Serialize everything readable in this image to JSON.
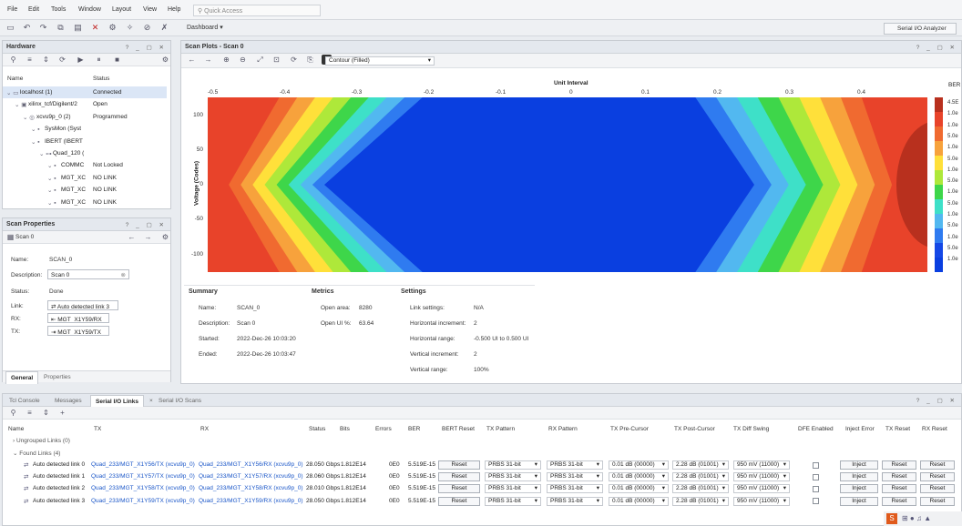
{
  "menu": [
    "File",
    "Edit",
    "Tools",
    "Window",
    "Layout",
    "View",
    "Help"
  ],
  "quick_access_placeholder": "Quick Access",
  "dashboard_label": "Dashboard",
  "analyzer_button": "Serial I/O Analyzer",
  "hardware": {
    "title": "Hardware",
    "col_name": "Name",
    "col_status": "Status",
    "rows": [
      {
        "name": "localhost (1)",
        "status": "Connected",
        "indent": 0
      },
      {
        "name": "xilinx_tcf/Digilent/2",
        "status": "Open",
        "indent": 1
      },
      {
        "name": "xcvu9p_0 (2)",
        "status": "Programmed",
        "indent": 2
      },
      {
        "name": "SysMon (Syst",
        "status": "",
        "indent": 3
      },
      {
        "name": "IBERT (IBERT",
        "status": "",
        "indent": 3
      },
      {
        "name": "Quad_120 (",
        "status": "",
        "indent": 4
      },
      {
        "name": "COMMC",
        "status": "Not Locked",
        "indent": 5
      },
      {
        "name": "MGT_XC",
        "status": "NO LINK",
        "indent": 5
      },
      {
        "name": "MGT_XC",
        "status": "NO LINK",
        "indent": 5
      },
      {
        "name": "MGT_XC",
        "status": "NO LINK",
        "indent": 5
      }
    ]
  },
  "scan_props": {
    "title": "Scan Properties",
    "scan_name": "Scan 0",
    "fields": {
      "name_label": "Name:",
      "name_value": "SCAN_0",
      "desc_label": "Description:",
      "desc_value": "Scan 0",
      "status_label": "Status:",
      "status_value": "Done",
      "link_label": "Link:",
      "link_value": "Auto detected link 3",
      "rx_label": "RX:",
      "rx_value": "MGT_X1Y59/RX",
      "tx_label": "TX:",
      "tx_value": "MGT_X1Y59/TX"
    },
    "tab_general": "General",
    "tab_properties": "Properties"
  },
  "scan_plots": {
    "title": "Scan Plots - Scan 0",
    "plot_type": "Contour (Filled)",
    "x_axis_label": "Unit Interval",
    "y_axis_label": "Voltage (Codes)",
    "ber_label": "BER",
    "x_ticks": [
      "-0.5",
      "-0.4",
      "-0.3",
      "-0.2",
      "-0.1",
      "0",
      "0.1",
      "0.2",
      "0.3",
      "0.4"
    ],
    "y_ticks": [
      "100",
      "50",
      "0",
      "-50",
      "-100"
    ],
    "cbar_labels": [
      "4.5E",
      "1.0e",
      "1.0e",
      "5.0e",
      "1.0e",
      "5.0e",
      "1.0e",
      "5.0e",
      "1.0e",
      "5.0e",
      "1.0e",
      "5.0e",
      "1.0e",
      "5.0e",
      "1.0e"
    ]
  },
  "summary": {
    "title": "Summary",
    "name_label": "Name:",
    "name_value": "SCAN_0",
    "desc_label": "Description:",
    "desc_value": "Scan 0",
    "started_label": "Started:",
    "started_value": "2022-Dec-26 10:03:20",
    "ended_label": "Ended:",
    "ended_value": "2022-Dec-26 10:03:47"
  },
  "metrics": {
    "title": "Metrics",
    "open_area_label": "Open area:",
    "open_area_value": "8280",
    "open_ui_label": "Open UI %:",
    "open_ui_value": "63.64"
  },
  "settings": {
    "title": "Settings",
    "link_label": "Link settings:",
    "link_value": "N/A",
    "hinc_label": "Horizontal increment:",
    "hinc_value": "2",
    "hrange_label": "Horizontal range:",
    "hrange_value": "-0.500 UI to 0.500 UI",
    "vinc_label": "Vertical increment:",
    "vinc_value": "2",
    "vrange_label": "Vertical range:",
    "vrange_value": "100%"
  },
  "bottom_tabs": [
    "Tcl Console",
    "Messages",
    "Serial I/O Links",
    "Serial I/O Scans"
  ],
  "links_table": {
    "headers": [
      "Name",
      "TX",
      "RX",
      "Status",
      "Bits",
      "Errors",
      "BER",
      "BERT Reset",
      "TX Pattern",
      "RX Pattern",
      "TX Pre-Cursor",
      "TX Post-Cursor",
      "TX Diff Swing",
      "DFE Enabled",
      "Inject Error",
      "TX Reset",
      "RX Reset"
    ],
    "group_ungrouped": "Ungrouped Links (0)",
    "group_found": "Found Links (4)",
    "rows": [
      {
        "name": "Auto detected link 0",
        "tx": "Quad_233/MGT_X1Y56/TX (xcvu9p_0)",
        "rx": "Quad_233/MGT_X1Y56/RX (xcvu9p_0)",
        "status": "28.050 Gbps",
        "bits": "1.812E14",
        "errors": "0E0",
        "ber": "5.519E-15",
        "tx_pattern": "PRBS 31-bit",
        "rx_pattern": "PRBS 31-bit",
        "pre": "0.01 dB (00000)",
        "post": "2.28 dB (01001)",
        "swing": "950 mV (11000)"
      },
      {
        "name": "Auto detected link 1",
        "tx": "Quad_233/MGT_X1Y57/TX (xcvu9p_0)",
        "rx": "Quad_233/MGT_X1Y57/RX (xcvu9p_0)",
        "status": "28.060 Gbps",
        "bits": "1.812E14",
        "errors": "0E0",
        "ber": "5.519E-15",
        "tx_pattern": "PRBS 31-bit",
        "rx_pattern": "PRBS 31-bit",
        "pre": "0.01 dB (00000)",
        "post": "2.28 dB (01001)",
        "swing": "950 mV (11000)"
      },
      {
        "name": "Auto detected link 2",
        "tx": "Quad_233/MGT_X1Y58/TX (xcvu9p_0)",
        "rx": "Quad_233/MGT_X1Y58/RX (xcvu9p_0)",
        "status": "28.010 Gbps",
        "bits": "1.812E14",
        "errors": "0E0",
        "ber": "5.519E-15",
        "tx_pattern": "PRBS 31-bit",
        "rx_pattern": "PRBS 31-bit",
        "pre": "0.01 dB (00000)",
        "post": "2.28 dB (01001)",
        "swing": "950 mV (11000)"
      },
      {
        "name": "Auto detected link 3",
        "tx": "Quad_233/MGT_X1Y59/TX (xcvu9p_0)",
        "rx": "Quad_233/MGT_X1Y59/RX (xcvu9p_0)",
        "status": "28.050 Gbps",
        "bits": "1.812E14",
        "errors": "0E0",
        "ber": "5.519E-15",
        "tx_pattern": "PRBS 31-bit",
        "rx_pattern": "PRBS 31-bit",
        "pre": "0.01 dB (00000)",
        "post": "2.28 dB (01001)",
        "swing": "950 mV (11000)"
      }
    ],
    "btn_reset": "Reset",
    "btn_inject": "Inject"
  },
  "colors": {
    "blue_eye": "#0a3fe0",
    "contours": [
      "#e8432a",
      "#f06a30",
      "#f7a23c",
      "#ffe03a",
      "#aee83a",
      "#3ed64a",
      "#3ee0c8",
      "#52b8f0",
      "#2f7bf0",
      "#1548e6"
    ],
    "link": "#1a56c8",
    "panel_header": "#e4e8ee"
  }
}
